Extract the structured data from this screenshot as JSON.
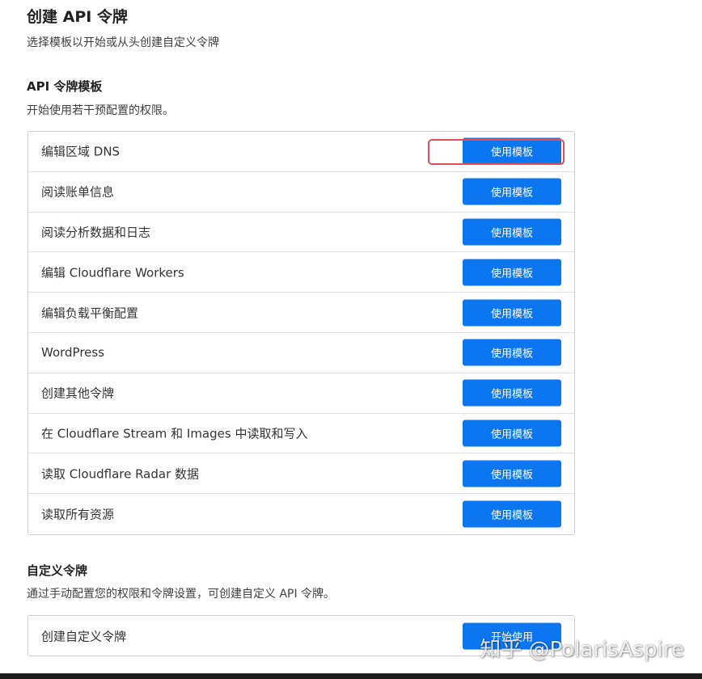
{
  "header": {
    "title": "创建 API 令牌",
    "subtitle": "选择模板以开始或从头创建自定义令牌"
  },
  "templates_section": {
    "title": "API 令牌模板",
    "description": "开始使用若干预配置的权限。",
    "button_label": "使用模板",
    "items": [
      {
        "label": "编辑区域 DNS"
      },
      {
        "label": "阅读账单信息"
      },
      {
        "label": "阅读分析数据和日志"
      },
      {
        "label": "编辑 Cloudflare Workers"
      },
      {
        "label": "编辑负载平衡配置"
      },
      {
        "label": "WordPress"
      },
      {
        "label": "创建其他令牌"
      },
      {
        "label": "在 Cloudflare Stream 和 Images 中读取和写入"
      },
      {
        "label": "读取 Cloudflare Radar 数据"
      },
      {
        "label": "读取所有资源"
      }
    ]
  },
  "custom_section": {
    "title": "自定义令牌",
    "description": "通过手动配置您的权限和令牌设置，可创建自定义 API 令牌。",
    "item_label": "创建自定义令牌",
    "button_label": "开始使用"
  },
  "watermark": "知乎 @PolarisAspire",
  "colors": {
    "primary_button": "#0b76f0",
    "highlight_border": "#e04e59"
  }
}
